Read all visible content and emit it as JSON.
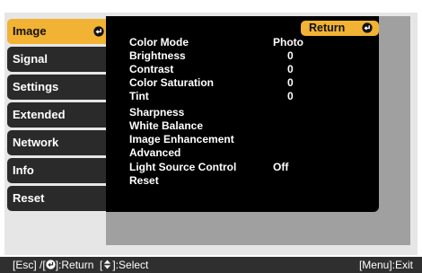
{
  "sidebar": {
    "items": [
      {
        "label": "Image",
        "active": true
      },
      {
        "label": "Signal"
      },
      {
        "label": "Settings"
      },
      {
        "label": "Extended"
      },
      {
        "label": "Network"
      },
      {
        "label": "Info"
      },
      {
        "label": "Reset"
      }
    ]
  },
  "panel": {
    "return_label": "Return",
    "rows": [
      {
        "label": "Color Mode",
        "value": "Photo"
      },
      {
        "label": "Brightness",
        "value": "0"
      },
      {
        "label": "Contrast",
        "value": "0"
      },
      {
        "label": "Color Saturation",
        "value": "0"
      },
      {
        "label": "Tint",
        "value": "0"
      },
      {
        "label": "Sharpness",
        "value": ""
      },
      {
        "label": "White Balance",
        "value": ""
      },
      {
        "label": "Image Enhancement",
        "value": ""
      },
      {
        "label": "Advanced",
        "value": ""
      },
      {
        "label": "Light Source Control",
        "value": "Off"
      },
      {
        "label": "Reset",
        "value": ""
      }
    ]
  },
  "footer": {
    "esc_part": "[Esc] /[",
    "return_part": "]:Return  [",
    "select_part": "]:Select",
    "menu_exit": "[Menu]:Exit"
  },
  "colors": {
    "accent": "#f2b233",
    "menu_bg": "#000000",
    "item_bg": "#2a2a2a",
    "panel_gray": "#a0a0a0",
    "footer_bg": "#2f2f2f"
  }
}
